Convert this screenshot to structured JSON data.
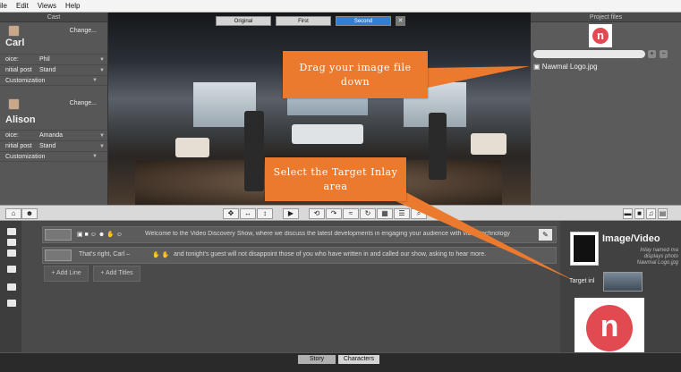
{
  "menu": {
    "items": [
      "ile",
      "Edit",
      "Views",
      "Help"
    ]
  },
  "cast": {
    "title": "Cast",
    "characters": [
      {
        "name": "Carl",
        "change_label": "Change...",
        "voice_key": "oice:",
        "voice_value": "Phil",
        "post_key": "nitial post",
        "post_value": "Stand",
        "custom_label": "Customization"
      },
      {
        "name": "Alison",
        "change_label": "Change...",
        "voice_key": "oice:",
        "voice_value": "Amanda",
        "post_key": "nitial post",
        "post_value": "Stand",
        "custom_label": "Customization"
      }
    ]
  },
  "stage": {
    "tabs": [
      "Original",
      "First",
      "Second"
    ],
    "selected_tab": "Second",
    "close_label": "✕"
  },
  "files": {
    "title": "Project files",
    "logo_letter": "n",
    "add_label": "+",
    "remove_label": "−",
    "file_name": "Nawmal Logo.jpg"
  },
  "story": {
    "lines": [
      {
        "text": "Welcome to the Video Discovery Show, where we discuss the latest developments in engaging your audience with video technology"
      },
      {
        "text_prefix": "That's right, Carl –",
        "text": "and tonight's guest will not disappoint those of you who have written in and called our show, asking to hear more."
      }
    ],
    "add_line_label": "+ Add Line",
    "add_titles_label": "+ Add Titles"
  },
  "props": {
    "title": "Image/Video",
    "desc": [
      "Inlay named ma",
      "displays photo",
      "Nawmal Logo.jpg"
    ],
    "target_label": "Target inl",
    "logo_letter": "n"
  },
  "bottom_tabs": [
    "Story",
    "Characters"
  ],
  "callouts": {
    "drag": "Drag your image file down",
    "select": "Select the Target Inlay area"
  },
  "colors": {
    "accent": "#2f7fd6",
    "callout": "#ec7a2e",
    "logo": "#e24a52"
  }
}
